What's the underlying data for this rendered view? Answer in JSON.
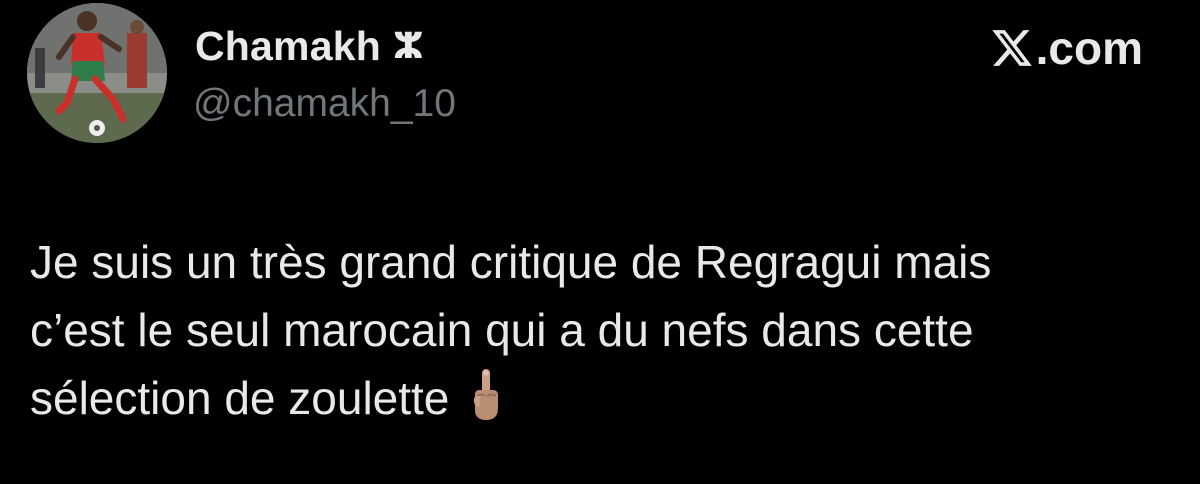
{
  "author": {
    "display_name": "Chamakh",
    "name_emoji": "ⵣ",
    "handle": "@chamakh_10",
    "avatar_icon": "avatar-footballer-photo"
  },
  "brand": {
    "logo_icon": "x-logo-icon",
    "text": ".com"
  },
  "tweet": {
    "lines": [
      "Je suis un très grand critique de Regragui mais",
      "c’est le seul marocain qui a du nefs dans cette",
      "sélection de zoulette"
    ],
    "trailing_emoji": "middle-finger-emoji"
  },
  "colors": {
    "background": "#000000",
    "text_primary": "#e7e9ea",
    "text_secondary": "#71767b"
  }
}
